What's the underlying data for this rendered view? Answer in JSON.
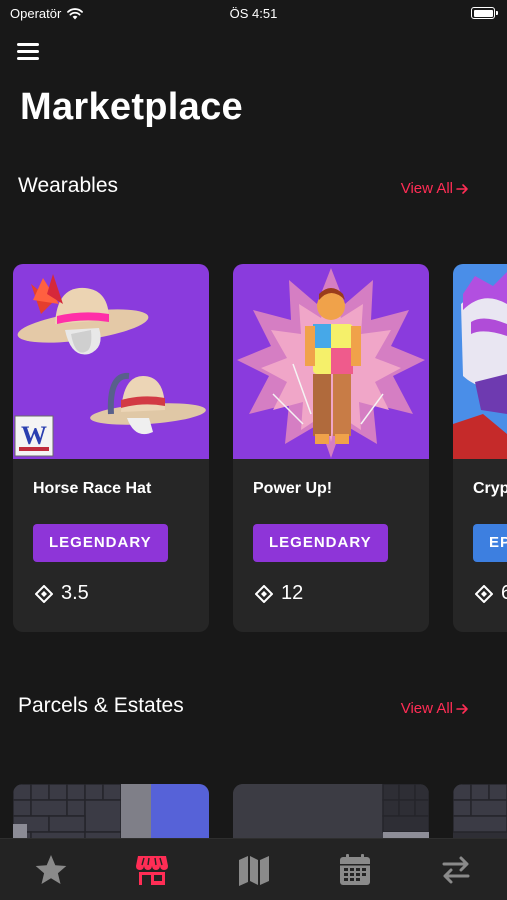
{
  "status_bar": {
    "carrier": "Operatör",
    "time": "ÖS 4:51"
  },
  "header": {
    "title": "Marketplace"
  },
  "wearables": {
    "title": "Wearables",
    "view_all": "View All",
    "items": [
      {
        "name": "Horse Race Hat",
        "rarity": "LEGENDARY",
        "price": "3.5",
        "rarity_color": "#8e35d8",
        "thumb_color": "#8a3bdd"
      },
      {
        "name": "Power Up!",
        "rarity": "LEGENDARY",
        "price": "12",
        "rarity_color": "#8e35d8",
        "thumb_color": "#8a3bdd"
      },
      {
        "name": "Cryp",
        "rarity": "EP",
        "price": "6",
        "rarity_color": "#3d7fe0",
        "thumb_color": "#4a8ee8"
      }
    ]
  },
  "parcels": {
    "title": "Parcels & Estates",
    "view_all": "View All"
  },
  "tabs": [
    {
      "icon": "star-icon",
      "active": false
    },
    {
      "icon": "store-icon",
      "active": true
    },
    {
      "icon": "map-icon",
      "active": false
    },
    {
      "icon": "calendar-icon",
      "active": false
    },
    {
      "icon": "swap-icon",
      "active": false
    }
  ],
  "colors": {
    "accent": "#ff2d55",
    "background": "#181818",
    "card": "#262626",
    "inactive_icon": "#8a8a8a"
  }
}
